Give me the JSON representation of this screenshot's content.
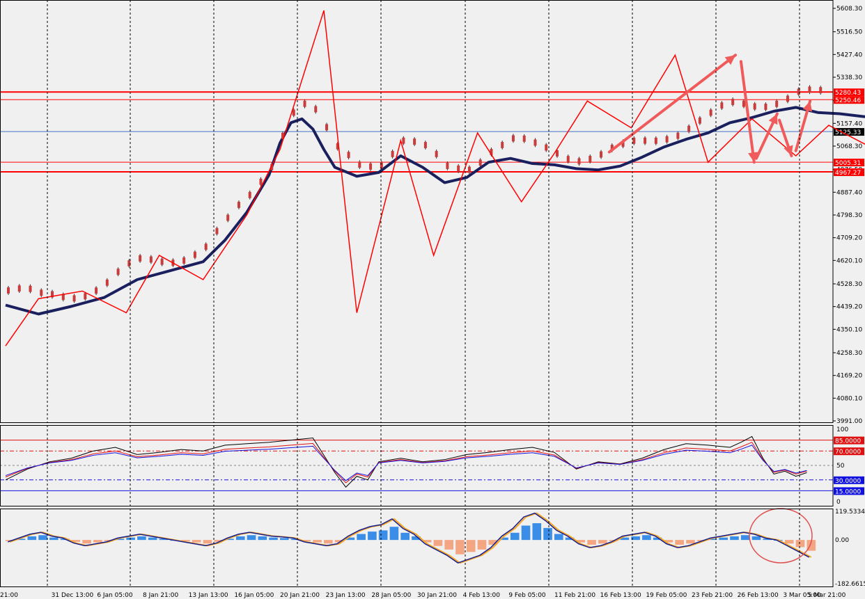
{
  "colors": {
    "background": "#f0f0f0",
    "ma_thick": "#1a1f5e",
    "zigzag": "#ff0000",
    "arrow": "#f05a5a",
    "price_line": "#4472c4",
    "rsi_black": "#000000",
    "rsi_red": "#e01010",
    "rsi_blue": "#1010e0",
    "hist_pos": "#3b8ee8",
    "hist_neg": "#f4a582",
    "macd_line": "#1a1f8e",
    "signal_line": "#f5a623",
    "circle": "#e05050"
  },
  "chart_data": [
    {
      "type": "line",
      "panel": "price",
      "y_ticks": [
        "5608.30",
        "5516.50",
        "5427.40",
        "5338.30",
        "5247.40",
        "5157.40",
        "5068.30",
        "4976.50",
        "4887.40",
        "4798.30",
        "4709.20",
        "4620.10",
        "4528.30",
        "4439.20",
        "4350.10",
        "4258.30",
        "4169.20",
        "4080.10",
        "3991.00"
      ],
      "ylim": [
        3991.0,
        5608.3
      ],
      "x_labels": [
        "21:00",
        "31 Dec 13:00",
        "6 Jan 05:00",
        "8 Jan 21:00",
        "13 Jan 13:00",
        "16 Jan 05:00",
        "20 Jan 21:00",
        "23 Jan 13:00",
        "28 Jan 05:00",
        "30 Jan 21:00",
        "4 Feb 13:00",
        "9 Feb 05:00",
        "11 Feb 21:00",
        "16 Feb 13:00",
        "19 Feb 05:00",
        "23 Feb 21:00",
        "26 Feb 13:00",
        "3 Mar 05:00",
        "5 Mar 21:00"
      ],
      "horizontal_levels": [
        {
          "value": 5280.43,
          "label": "5280.43"
        },
        {
          "value": 5250.46,
          "label": "5250.46"
        },
        {
          "value": 5005.31,
          "label": "5005.31"
        },
        {
          "value": 4967.27,
          "label": "4967.27"
        }
      ],
      "current_price": {
        "value": 5125.33,
        "label": "5125.33"
      },
      "series": [
        {
          "x": [
            0,
            3,
            7,
            11,
            14,
            18,
            22,
            25,
            29,
            32,
            36,
            39,
            43,
            47,
            50,
            53,
            57,
            61,
            64,
            68,
            72,
            75,
            79
          ],
          "values": [
            4285,
            4470,
            4500,
            4415,
            4640,
            4545,
            4800,
            5055,
            5600,
            4415,
            5090,
            4640,
            5120,
            4850,
            5040,
            5245,
            5140,
            5425,
            5005,
            5175,
            5030,
            5150,
            5060
          ]
        },
        {
          "x": [
            0,
            3,
            6,
            9,
            12,
            15,
            18,
            20,
            22,
            24,
            25,
            26,
            27,
            28,
            29,
            30,
            32,
            34,
            36,
            38,
            40,
            42,
            44,
            46,
            48,
            50,
            52,
            54,
            56,
            58,
            60,
            62,
            64,
            66,
            68,
            70,
            72,
            74,
            76,
            78,
            80
          ],
          "values": [
            4445,
            4410,
            4440,
            4475,
            4545,
            4580,
            4615,
            4700,
            4810,
            4955,
            5080,
            5160,
            5175,
            5135,
            5055,
            4985,
            4950,
            4965,
            5030,
            4985,
            4925,
            4945,
            5005,
            5020,
            5000,
            4995,
            4980,
            4975,
            4990,
            5025,
            5065,
            5095,
            5120,
            5160,
            5180,
            5205,
            5220,
            5200,
            5195,
            5185,
            5175
          ]
        }
      ],
      "arrows": [
        {
          "x1": 55,
          "y1": 5045,
          "x2": 66.5,
          "y2": 5425
        },
        {
          "x1": 67.0,
          "y1": 5400,
          "x2": 68.2,
          "y2": 5005
        },
        {
          "x1": 68.4,
          "y1": 5020,
          "x2": 70.3,
          "y2": 5195
        },
        {
          "x1": 70.5,
          "y1": 5170,
          "x2": 71.6,
          "y2": 5030
        },
        {
          "x1": 72.0,
          "y1": 5050,
          "x2": 73.3,
          "y2": 5245
        }
      ]
    },
    {
      "type": "line",
      "panel": "rsi",
      "ylim": [
        0,
        100
      ],
      "y_ticks": [
        "100",
        "85.0000",
        "70.0000",
        "50",
        "30.0000",
        "15.0000",
        "0"
      ],
      "levels": [
        85,
        70,
        50,
        30,
        15
      ],
      "series": [
        {
          "x": [
            0,
            2,
            4,
            6,
            8,
            10,
            12,
            14,
            16,
            18,
            20,
            22,
            24,
            26,
            28,
            30,
            31,
            32,
            33,
            34,
            36,
            38,
            40,
            42,
            44,
            46,
            48,
            50,
            52,
            54,
            56,
            58,
            60,
            62,
            64,
            66,
            67,
            68,
            69,
            70,
            71,
            72,
            73
          ],
          "values": [
            30,
            45,
            55,
            60,
            70,
            75,
            65,
            68,
            72,
            70,
            78,
            80,
            82,
            85,
            88,
            40,
            20,
            35,
            30,
            55,
            60,
            55,
            58,
            65,
            68,
            72,
            75,
            68,
            45,
            55,
            52,
            60,
            72,
            80,
            78,
            75,
            82,
            90,
            60,
            38,
            42,
            35,
            40
          ]
        }
      ]
    },
    {
      "type": "bar",
      "panel": "macd",
      "ylim": [
        -182.6615,
        119.5334
      ],
      "y_ticks": [
        "119.5334",
        "0.00",
        "-182.6615"
      ],
      "categories": [
        0,
        1,
        2,
        3,
        4,
        5,
        6,
        7,
        8,
        9,
        10,
        11,
        12,
        13,
        14,
        15,
        16,
        17,
        18,
        19,
        20,
        21,
        22,
        23,
        24,
        25,
        26,
        27,
        28,
        29,
        30,
        31,
        32,
        33,
        34,
        35,
        36,
        37,
        38,
        39,
        40,
        41,
        42,
        43,
        44,
        45,
        46,
        47,
        48,
        49,
        50,
        51,
        52,
        53,
        54,
        55,
        56,
        57,
        58,
        59,
        60,
        61,
        62,
        63,
        64,
        65,
        66,
        67,
        68,
        69,
        70,
        71,
        72,
        73
      ],
      "values": [
        -5,
        5,
        15,
        20,
        10,
        5,
        -8,
        -15,
        -10,
        -5,
        5,
        10,
        15,
        10,
        5,
        0,
        -5,
        -10,
        -15,
        -8,
        5,
        15,
        20,
        15,
        10,
        8,
        5,
        -5,
        -10,
        -15,
        -10,
        10,
        25,
        35,
        40,
        55,
        30,
        15,
        -10,
        -25,
        -40,
        -60,
        -50,
        -40,
        -20,
        10,
        30,
        60,
        70,
        50,
        25,
        10,
        -10,
        -20,
        -15,
        -5,
        10,
        15,
        20,
        10,
        -10,
        -20,
        -15,
        -5,
        5,
        10,
        15,
        20,
        15,
        5,
        0,
        -15,
        -30,
        -45
      ]
    }
  ]
}
